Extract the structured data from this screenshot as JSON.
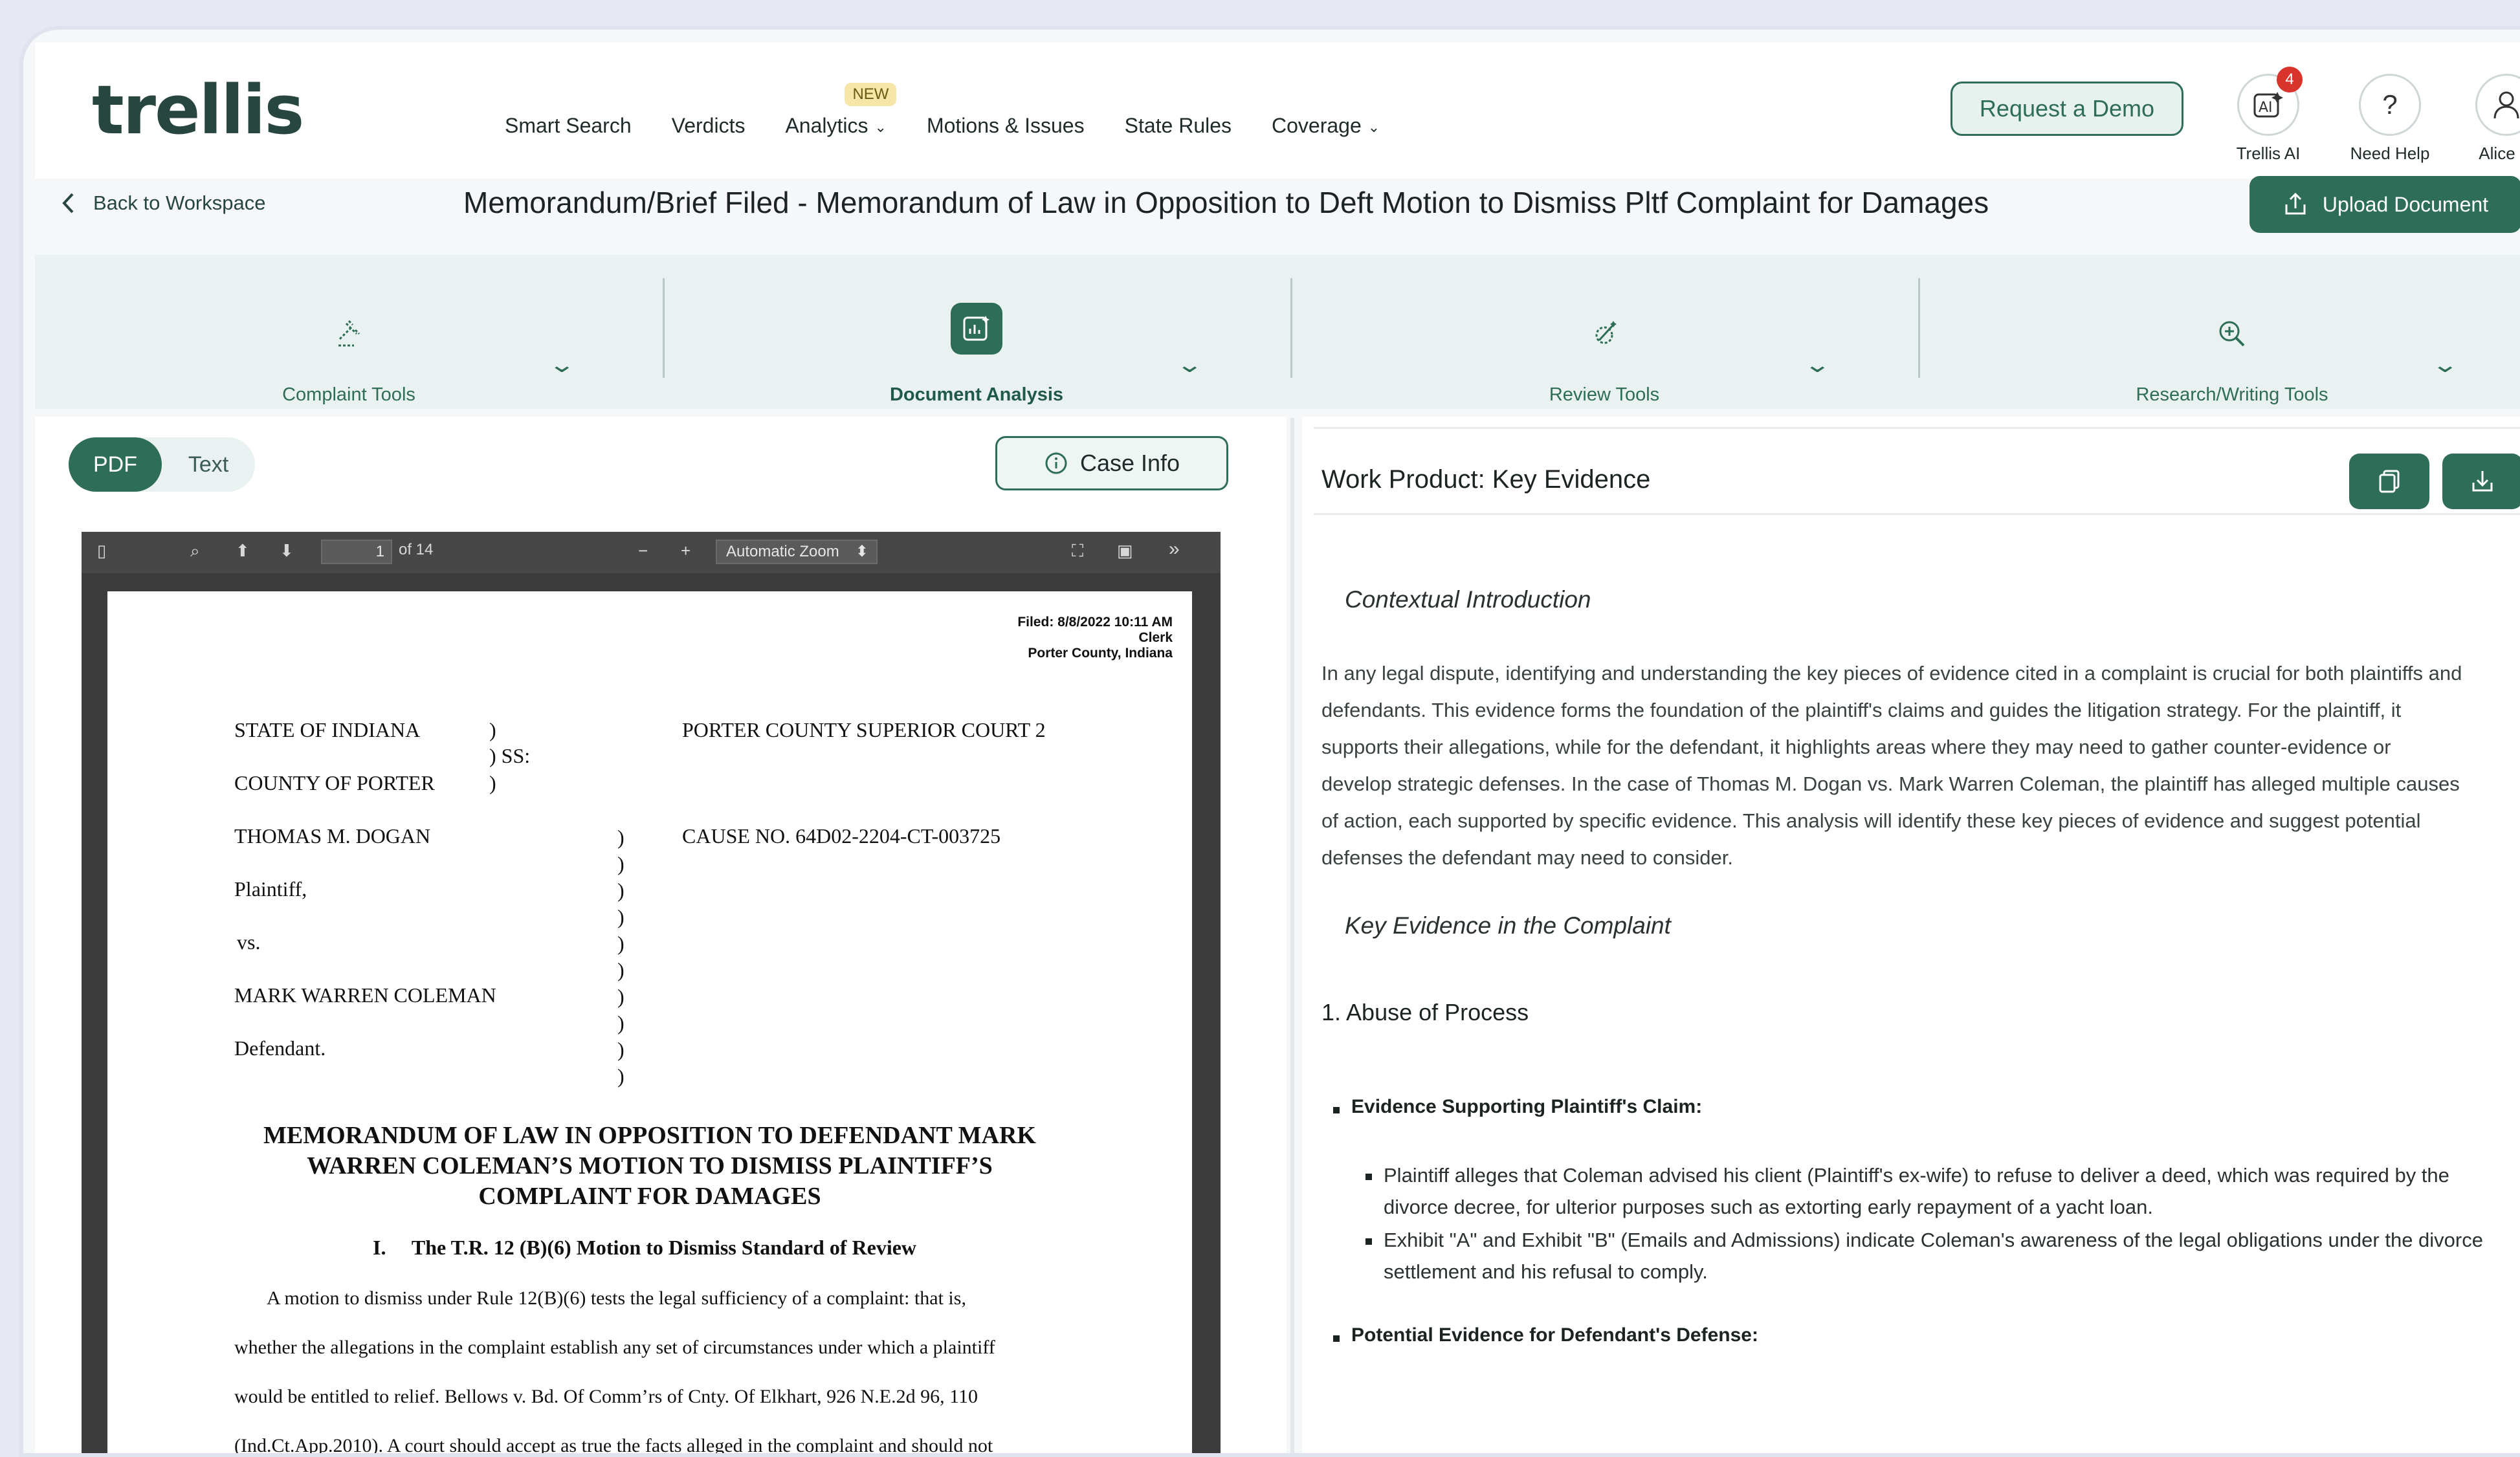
{
  "brand": {
    "logo": "trellis",
    "accent": "#2e6d58"
  },
  "nav": {
    "links": [
      "Smart Search",
      "Verdicts",
      "Analytics",
      "Motions & Issues",
      "State Rules",
      "Coverage"
    ],
    "analytics_badge": "NEW",
    "demo_button": "Request a Demo",
    "trellis_ai": {
      "label": "Trellis AI",
      "badge": "4",
      "icon": "ai-icon"
    },
    "help": {
      "label": "Need Help",
      "icon": "question-icon"
    },
    "user": {
      "label": "Alice",
      "icon": "user-icon"
    }
  },
  "titlebar": {
    "back": "Back to Workspace",
    "title": "Memorandum/Brief Filed - Memorandum of Law in Opposition to Deft Motion to Dismiss Pltf Complaint for Damages",
    "upload": "Upload Document"
  },
  "tools": [
    {
      "label": "Complaint Tools",
      "icon": "gavel-icon",
      "active": false
    },
    {
      "label": "Document Analysis",
      "icon": "chart-icon",
      "active": true
    },
    {
      "label": "Review Tools",
      "icon": "edit-review-icon",
      "active": false
    },
    {
      "label": "Research/Writing Tools",
      "icon": "magnify-icon",
      "active": false
    }
  ],
  "left": {
    "toggle": [
      "PDF",
      "Text"
    ],
    "toggle_selected": "PDF",
    "case_info": "Case Info",
    "pdf": {
      "page": "1",
      "of_pages": "of 14",
      "zoom": "Automatic Zoom",
      "filed_lines": [
        "Filed: 8/8/2022 10:11 AM",
        "Clerk",
        "Porter County, Indiana"
      ],
      "state": "STATE OF INDIANA",
      "county": "COUNTY OF PORTER",
      "ss": ") SS:",
      "court": "PORTER COUNTY SUPERIOR COURT 2",
      "plaintiff_name": "THOMAS M. DOGAN",
      "cause": "CAUSE NO. 64D02-2204-CT-003725",
      "plaintiff_role": "Plaintiff,",
      "vs": "vs.",
      "defendant_name": "MARK WARREN COLEMAN",
      "defendant_role": "Defendant.",
      "heading": [
        "MEMORANDUM OF LAW IN OPPOSITION TO DEFENDANT MARK",
        "WARREN COLEMAN’S MOTION TO DISMISS PLAINTIFF’S",
        "COMPLAINT FOR DAMAGES"
      ],
      "section": "I.     The T.R. 12 (B)(6) Motion to Dismiss Standard of Review",
      "body": [
        "A motion to dismiss under Rule 12(B)(6) tests the legal sufficiency of a complaint: that is,",
        "whether the allegations in the complaint establish any set of circumstances under which a plaintiff",
        "would be entitled to relief. Bellows v. Bd. Of Comm’rs of Cnty. Of Elkhart, 926 N.E.2d 96, 110",
        "(Ind.Ct.App.2010). A court should accept as true the facts alleged in the complaint and should not"
      ]
    }
  },
  "right": {
    "title": "Work Product: Key Evidence",
    "copy_icon": "copy-icon",
    "download_icon": "download-icon",
    "intro_heading": "Contextual Introduction",
    "intro_lines": [
      "In any legal dispute, identifying and understanding the key pieces of evidence cited in a complaint is crucial for both plaintiffs and",
      "defendants. This evidence forms the foundation of the plaintiff's claims and guides the litigation strategy. For the plaintiff, it",
      "supports their allegations, while for the defendant, it highlights areas where they may need to gather counter-evidence or",
      "develop strategic defenses. In the case of Thomas M. Dogan vs. Mark Warren Coleman, the plaintiff has alleged multiple causes",
      "of action, each supported by specific evidence. This analysis will identify these key pieces of evidence and suggest potential",
      "defenses the defendant may need to consider."
    ],
    "key_heading": "Key Evidence in the Complaint",
    "section1": "1. Abuse of Process",
    "support_label": "Evidence Supporting Plaintiff's Claim:",
    "support_items": [
      [
        "Plaintiff alleges that Coleman advised his client (Plaintiff's ex-wife) to refuse to deliver a deed, which was required by the",
        "divorce decree, for ulterior purposes such as extorting early repayment of a yacht loan."
      ],
      [
        "Exhibit \"A\" and Exhibit \"B\" (Emails and Admissions) indicate Coleman's awareness of the legal obligations under the divorce",
        "settlement and his refusal to comply."
      ]
    ],
    "defense_label": "Potential Evidence for Defendant's Defense:"
  }
}
